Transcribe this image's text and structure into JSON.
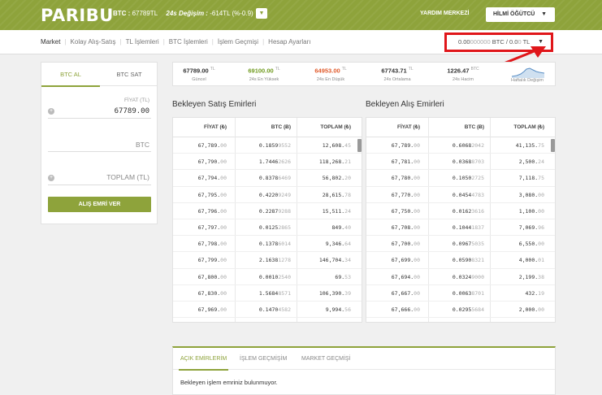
{
  "header": {
    "logo": "PARIBU",
    "ticker_pair": "BTC :",
    "ticker_price": "67789TL",
    "ticker_change_label": "24s Değişim :",
    "ticker_change_value": "-614TL (%-0.9)",
    "help": "YARDIM MERKEZİ",
    "user": "HİLMİ ÖĞÜTCÜ"
  },
  "subnav": {
    "items": [
      "Market",
      "Kolay Alış-Satış",
      "TL İşlemleri",
      "BTC İşlemleri",
      "İşlem Geçmişi",
      "Hesap Ayarları"
    ],
    "balance_btc_strong": "0.00",
    "balance_btc_faint": "000000",
    "balance_btc_unit": "BTC /",
    "balance_tl_strong": "0.0",
    "balance_tl_faint": "0",
    "balance_tl_unit": "TL"
  },
  "form": {
    "tab_buy": "BTC AL",
    "tab_sell": "BTC SAT",
    "price_label": "FİYAT (TL)",
    "price_value": "67789.00",
    "btc_placeholder": "BTC",
    "total_placeholder": "TOPLAM (TL)",
    "submit": "ALIŞ EMRİ VER"
  },
  "stats": [
    {
      "value": "67789.00",
      "unit": "TL",
      "label": "Güncel",
      "color": "#333333"
    },
    {
      "value": "69100.00",
      "unit": "TL",
      "label": "24s En Yüksek",
      "color": "#6f9a1e"
    },
    {
      "value": "64953.00",
      "unit": "TL",
      "label": "24s En Düşük",
      "color": "#e05a2b"
    },
    {
      "value": "67743.71",
      "unit": "TL",
      "label": "24s Ortalama",
      "color": "#333333"
    },
    {
      "value": "1226.47",
      "unit": "BTC",
      "label": "24s Hacim",
      "color": "#333333"
    },
    {
      "value": "",
      "unit": "",
      "label": "Haftalık Değişim",
      "color": "#333333"
    }
  ],
  "sell_orders": {
    "title": "Bekleyen Satış Emirleri",
    "headers": [
      "FİYAT (₺)",
      "BTC (Ƀ)",
      "TOPLAM (₺)"
    ],
    "rows": [
      [
        [
          "67,789.",
          "00"
        ],
        [
          "0.1859",
          "9552"
        ],
        [
          "12,608.",
          "45"
        ]
      ],
      [
        [
          "67,790.",
          "00"
        ],
        [
          "1.7446",
          "2626"
        ],
        [
          "118,268.",
          "21"
        ]
      ],
      [
        [
          "67,794.",
          "00"
        ],
        [
          "0.8378",
          "6469"
        ],
        [
          "56,802.",
          "20"
        ]
      ],
      [
        [
          "67,795.",
          "00"
        ],
        [
          "0.4220",
          "9249"
        ],
        [
          "28,615.",
          "78"
        ]
      ],
      [
        [
          "67,796.",
          "00"
        ],
        [
          "0.2287",
          "9288"
        ],
        [
          "15,511.",
          "24"
        ]
      ],
      [
        [
          "67,797.",
          "00"
        ],
        [
          "0.0125",
          "2865"
        ],
        [
          "849.",
          "40"
        ]
      ],
      [
        [
          "67,798.",
          "00"
        ],
        [
          "0.1378",
          "6014"
        ],
        [
          "9,346.",
          "64"
        ]
      ],
      [
        [
          "67,799.",
          "00"
        ],
        [
          "2.1638",
          "1278"
        ],
        [
          "146,704.",
          "34"
        ]
      ],
      [
        [
          "67,800.",
          "00"
        ],
        [
          "0.0010",
          "2540"
        ],
        [
          "69.",
          "53"
        ]
      ],
      [
        [
          "67,830.",
          "00"
        ],
        [
          "1.5684",
          "8571"
        ],
        [
          "106,390.",
          "39"
        ]
      ],
      [
        [
          "67,969.",
          "00"
        ],
        [
          "0.1470",
          "4582"
        ],
        [
          "9,994.",
          "56"
        ]
      ],
      [
        [
          "67,971.",
          "00"
        ],
        [
          "0.0237",
          "5316"
        ],
        [
          "1,616.",
          "50"
        ]
      ]
    ]
  },
  "buy_orders": {
    "title": "Bekleyen Alış Emirleri",
    "headers": [
      "FİYAT (₺)",
      "BTC (Ƀ)",
      "TOPLAM (₺)"
    ],
    "rows": [
      [
        [
          "67,789.",
          "00"
        ],
        [
          "0.6068",
          "2042"
        ],
        [
          "41,135.",
          "75"
        ]
      ],
      [
        [
          "67,781.",
          "00"
        ],
        [
          "0.0368",
          "8703"
        ],
        [
          "2,500.",
          "24"
        ]
      ],
      [
        [
          "67,780.",
          "00"
        ],
        [
          "0.1050",
          "2725"
        ],
        [
          "7,118.",
          "75"
        ]
      ],
      [
        [
          "67,770.",
          "00"
        ],
        [
          "0.0454",
          "4783"
        ],
        [
          "3,080.",
          "00"
        ]
      ],
      [
        [
          "67,750.",
          "00"
        ],
        [
          "0.0162",
          "3616"
        ],
        [
          "1,100.",
          "00"
        ]
      ],
      [
        [
          "67,708.",
          "00"
        ],
        [
          "0.1044",
          "1837"
        ],
        [
          "7,069.",
          "96"
        ]
      ],
      [
        [
          "67,700.",
          "00"
        ],
        [
          "0.0967",
          "5035"
        ],
        [
          "6,550.",
          "00"
        ]
      ],
      [
        [
          "67,699.",
          "00"
        ],
        [
          "0.0590",
          "8321"
        ],
        [
          "4,000.",
          "01"
        ]
      ],
      [
        [
          "67,694.",
          "00"
        ],
        [
          "0.0324",
          "9000"
        ],
        [
          "2,199.",
          "38"
        ]
      ],
      [
        [
          "67,667.",
          "00"
        ],
        [
          "0.0063",
          "8701"
        ],
        [
          "432.",
          "19"
        ]
      ],
      [
        [
          "67,666.",
          "00"
        ],
        [
          "0.0295",
          "5684"
        ],
        [
          "2,000.",
          "00"
        ]
      ],
      [
        [
          "67,665.",
          "00"
        ],
        [
          "0.0355",
          "6212"
        ],
        [
          "2,407.",
          "00"
        ]
      ]
    ]
  },
  "bottom": {
    "tabs": [
      "AÇIK EMİRLERİM",
      "İŞLEM GEÇMİŞİM",
      "MARKET GEÇMİŞİ"
    ],
    "message": "Bekleyen işlem emriniz bulunmuyor."
  },
  "colors": {
    "brand": "#8ea33b",
    "highlight": "#e0161a"
  }
}
